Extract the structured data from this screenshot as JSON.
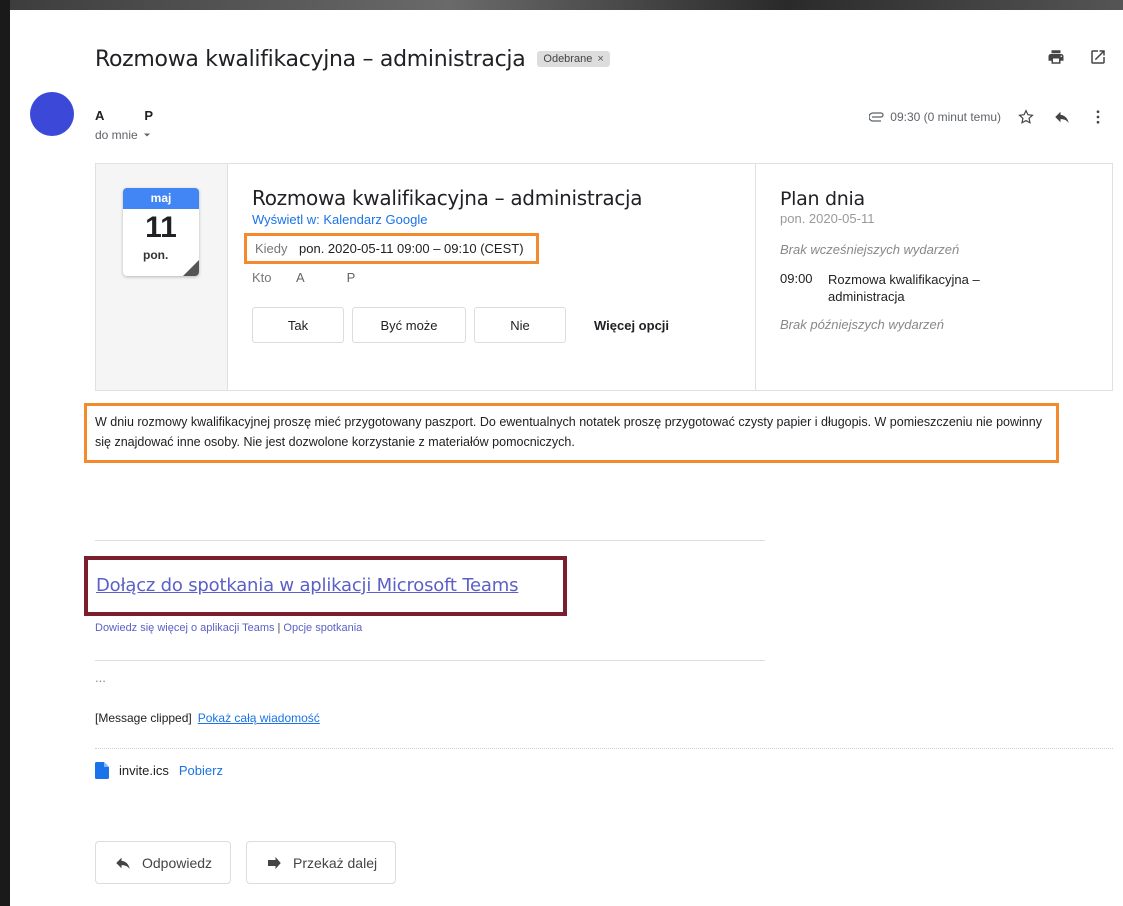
{
  "email": {
    "subject": "Rozmowa kwalifikacyjna – administracja",
    "label": "Odebrane",
    "label_close": "×",
    "sender_first": "A",
    "sender_last": "P",
    "to_me": "do mnie",
    "time": "09:30 (0 minut temu)"
  },
  "invite": {
    "month": "maj",
    "day": "11",
    "weekday": "pon.",
    "title": "Rozmowa kwalifikacyjna – administracja",
    "view_in_calendar": "Wyświetl w: Kalendarz Google",
    "when_label": "Kiedy",
    "when_value": "pon. 2020-05-11 09:00 – 09:10 (CEST)",
    "who_label": "Kto",
    "who_first": "A",
    "who_last": "P",
    "rsvp": {
      "yes": "Tak",
      "maybe": "Być może",
      "no": "Nie",
      "more": "Więcej opcji"
    }
  },
  "agenda": {
    "title": "Plan dnia",
    "date": "pon. 2020-05-11",
    "no_earlier": "Brak wcześniejszych wydarzeń",
    "event_time": "09:00",
    "event_name": "Rozmowa kwalifikacyjna – administracja",
    "no_later": "Brak późniejszych wydarzeń"
  },
  "description": "W dniu rozmowy kwalifikacyjnej proszę mieć przygotowany paszport. Do ewentualnych notatek proszę przygotować czysty papier i długopis. W pomieszczeniu nie powinny się znajdować inne osoby. Nie jest dozwolone korzystanie z materiałów pomocniczych.",
  "teams": {
    "join_link": "Dołącz do spotkania w aplikacji Microsoft Teams",
    "learn_more": "Dowiedz się więcej o aplikacji Teams",
    "separator": "|",
    "options": "Opcje spotkania"
  },
  "ellipsis": "...",
  "clipped": {
    "text": "[Message clipped]",
    "link": "Pokaż całą wiadomość"
  },
  "attachment": {
    "name": "invite.ics",
    "download": "Pobierz"
  },
  "actions": {
    "reply": "Odpowiedz",
    "forward": "Przekaż dalej"
  },
  "colors": {
    "accent": "#1a73e8",
    "highlight": "#f48a2e",
    "teams_frame": "#7b1f2e",
    "avatar": "#3b48d8"
  }
}
